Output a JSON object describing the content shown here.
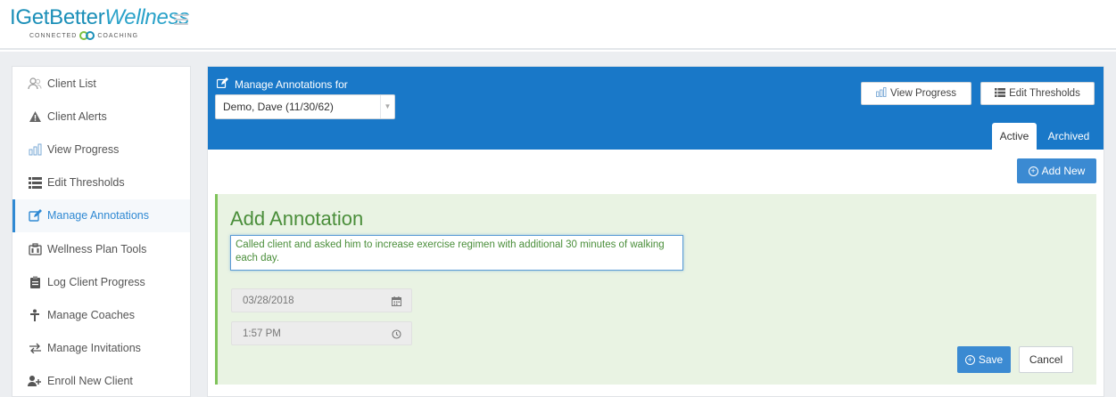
{
  "app": {
    "logo_part1": "IGetBetter",
    "logo_part2": "Wellness",
    "logo_tagline_left": "CONNECTED",
    "logo_tagline_right": "COACHING",
    "brand_color": "#1b8fb8"
  },
  "sidebar": {
    "items": [
      {
        "label": "Client List",
        "icon": "users-icon"
      },
      {
        "label": "Client Alerts",
        "icon": "warning-icon"
      },
      {
        "label": "View Progress",
        "icon": "bar-chart-icon"
      },
      {
        "label": "Edit Thresholds",
        "icon": "list-icon"
      },
      {
        "label": "Manage Annotations",
        "icon": "edit-icon",
        "active": true
      },
      {
        "label": "Wellness Plan Tools",
        "icon": "tools-icon"
      },
      {
        "label": "Log Client Progress",
        "icon": "clipboard-icon"
      },
      {
        "label": "Manage Coaches",
        "icon": "coach-icon"
      },
      {
        "label": "Manage Invitations",
        "icon": "exchange-icon"
      },
      {
        "label": "Enroll New Client",
        "icon": "add-user-icon"
      }
    ],
    "active_color": "#2f89d3"
  },
  "banner": {
    "title": "Manage Annotations for",
    "client_selected": "Demo, Dave (11/30/62)",
    "view_progress_label": "View Progress",
    "edit_thresholds_label": "Edit Thresholds",
    "tabs": [
      {
        "label": "Active",
        "active": true
      },
      {
        "label": "Archived",
        "active": false
      }
    ],
    "color": "#1978c8"
  },
  "actions": {
    "add_new_label": "Add New"
  },
  "annotation_form": {
    "title": "Add Annotation",
    "text": "Called client and asked him to increase exercise regimen with additional 30 minutes of walking each day.",
    "date": "03/28/2018",
    "time": "1:57 PM",
    "save_label": "Save",
    "cancel_label": "Cancel",
    "accent_color": "#7fc35a"
  }
}
